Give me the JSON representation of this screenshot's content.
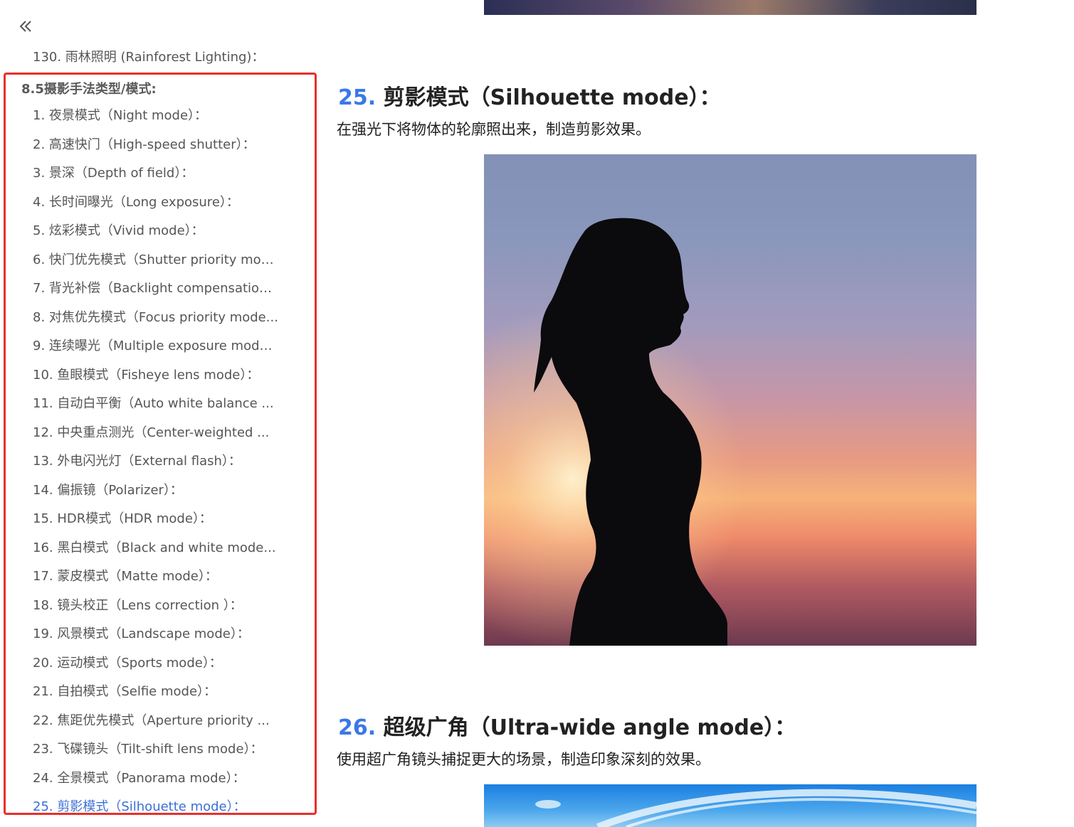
{
  "sidebar": {
    "collapse_icon": "double-chevron-left-icon",
    "prev_item": "130. 雨林照明 (Rainforest Lighting)：",
    "section_title": "8.5摄影手法类型/模式:",
    "items": [
      "1. 夜景模式（Night mode）：",
      "2. 高速快门（High-speed shutter）：",
      "3. 景深（Depth of field）：",
      "4. 长时间曝光（Long exposure）：",
      "5. 炫彩模式（Vivid mode）：",
      "6. 快门优先模式（Shutter priority mod...",
      "7. 背光补偿（Backlight compensation ...",
      "8. 对焦优先模式（Focus priority mode...",
      "9. 连续曝光（Multiple exposure mode...",
      "10. 鱼眼模式（Fisheye lens mode）：",
      "11. 自动白平衡（Auto white balance ...",
      "12. 中央重点测光（Center-weighted ...",
      "13. 外电闪光灯（External flash）：",
      "14. 偏振镜（Polarizer）：",
      "15. HDR模式（HDR mode）：",
      "16. 黑白模式（Black and white mode...",
      "17. 蒙皮模式（Matte mode）：",
      "18. 镜头校正（Lens correction ）：",
      "19. 风景模式（Landscape mode）：",
      "20. 运动模式（Sports mode）：",
      "21. 自拍模式（Selfie mode）：",
      "22. 焦距优先模式（Aperture priority ...",
      "23. 飞碟镜头（Tilt-shift lens mode）：",
      "24. 全景模式（Panorama mode）：",
      "25. 剪影模式（Silhouette mode）："
    ],
    "active_index": 24
  },
  "content": {
    "sections": [
      {
        "number": "25.",
        "title": "剪影模式（Silhouette mode）：",
        "description": "在强光下将物体的轮廓照出来，制造剪影效果。"
      },
      {
        "number": "26.",
        "title": "超级广角（Ultra-wide angle mode）：",
        "description": "使用超广角镜头捕捉更大的场景，制造印象深刻的效果。"
      }
    ]
  },
  "colors": {
    "highlight_border": "#e8302a",
    "active_link": "#3a6fd8",
    "heading_number": "#3a78e8"
  }
}
